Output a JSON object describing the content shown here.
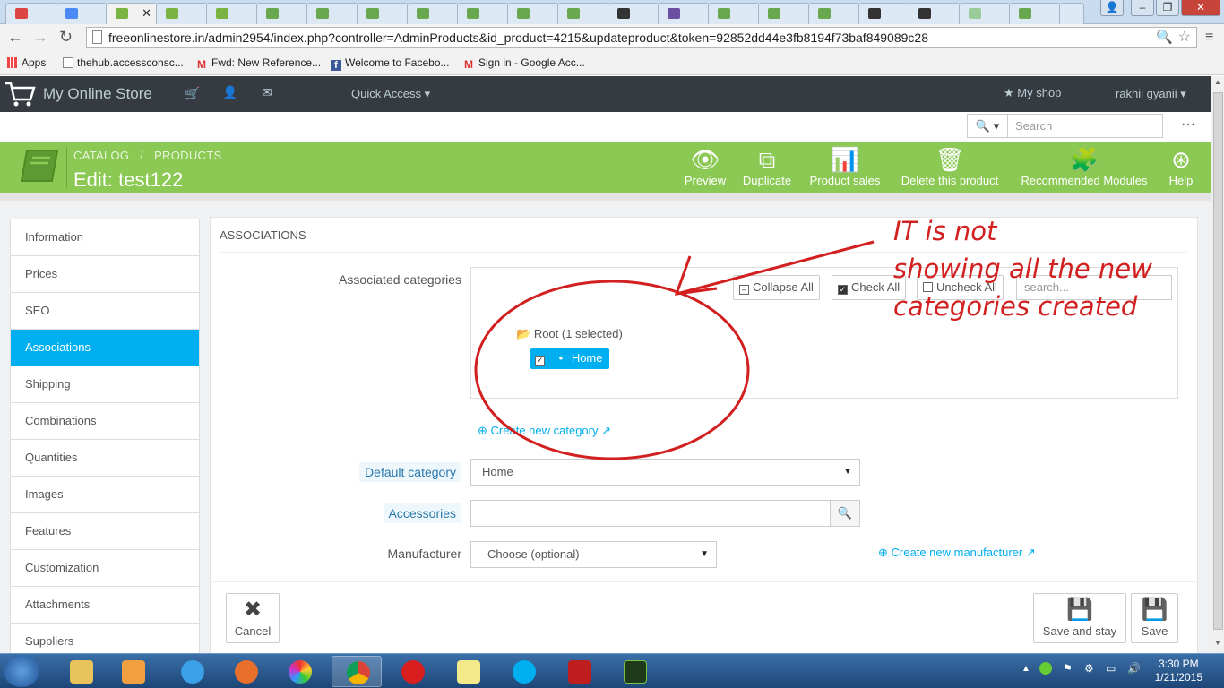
{
  "browser": {
    "address": "freeonlinestore.in/admin2954/index.php?controller=AdminProducts&id_product=4215&updateproduct&token=92852dd44e3fb8194f73baf849089c28",
    "bookmarks": [
      {
        "label": "Apps",
        "icon": "apps-grid-icon"
      },
      {
        "label": "thehub.accessconsc...",
        "icon": "page-icon"
      },
      {
        "label": "Fwd: New Reference...",
        "icon": "gmail-icon"
      },
      {
        "label": "Welcome to Facebo...",
        "icon": "facebook-icon"
      },
      {
        "label": "Sign in - Google Acc...",
        "icon": "gmail-icon"
      }
    ]
  },
  "header": {
    "store_name": "My Online Store",
    "quick_access": "Quick Access",
    "my_shop": "My shop",
    "user": "rakhii gyanii",
    "search_placeholder": "Search"
  },
  "toolbar": {
    "breadcrumb_catalog": "CATALOG",
    "breadcrumb_sep": "/",
    "breadcrumb_products": "PRODUCTS",
    "title": "Edit: test122",
    "buttons": [
      "Preview",
      "Duplicate",
      "Product sales",
      "Delete this product",
      "Recommended Modules",
      "Help"
    ]
  },
  "sidebar": {
    "items": [
      "Information",
      "Prices",
      "SEO",
      "Associations",
      "Shipping",
      "Combinations",
      "Quantities",
      "Images",
      "Features",
      "Customization",
      "Attachments",
      "Suppliers"
    ],
    "active": "Associations"
  },
  "panel": {
    "heading": "ASSOCIATIONS",
    "associated_categories_label": "Associated categories",
    "collapse_all": "Collapse All",
    "check_all": "Check All",
    "uncheck_all": "Uncheck All",
    "tree_search_placeholder": "search...",
    "root_label": "Root (1 selected)",
    "home_label": "Home",
    "create_category": "Create new category",
    "default_category_label": "Default category",
    "default_category_value": "Home",
    "accessories_label": "Accessories",
    "manufacturer_label": "Manufacturer",
    "manufacturer_value": "- Choose (optional) -",
    "create_manufacturer": "Create new manufacturer",
    "cancel": "Cancel",
    "save_and_stay": "Save and stay",
    "save": "Save"
  },
  "annotation": {
    "line1": "IT is not",
    "line2": "showing all the new",
    "line3": "categories created",
    "color": "#d21f1f"
  },
  "taskbar": {
    "time": "3:30 PM",
    "date": "1/21/2015"
  },
  "colors": {
    "toolbar_green": "#8bc954",
    "accent_blue": "#00aff0",
    "header_dark": "#363a41"
  }
}
